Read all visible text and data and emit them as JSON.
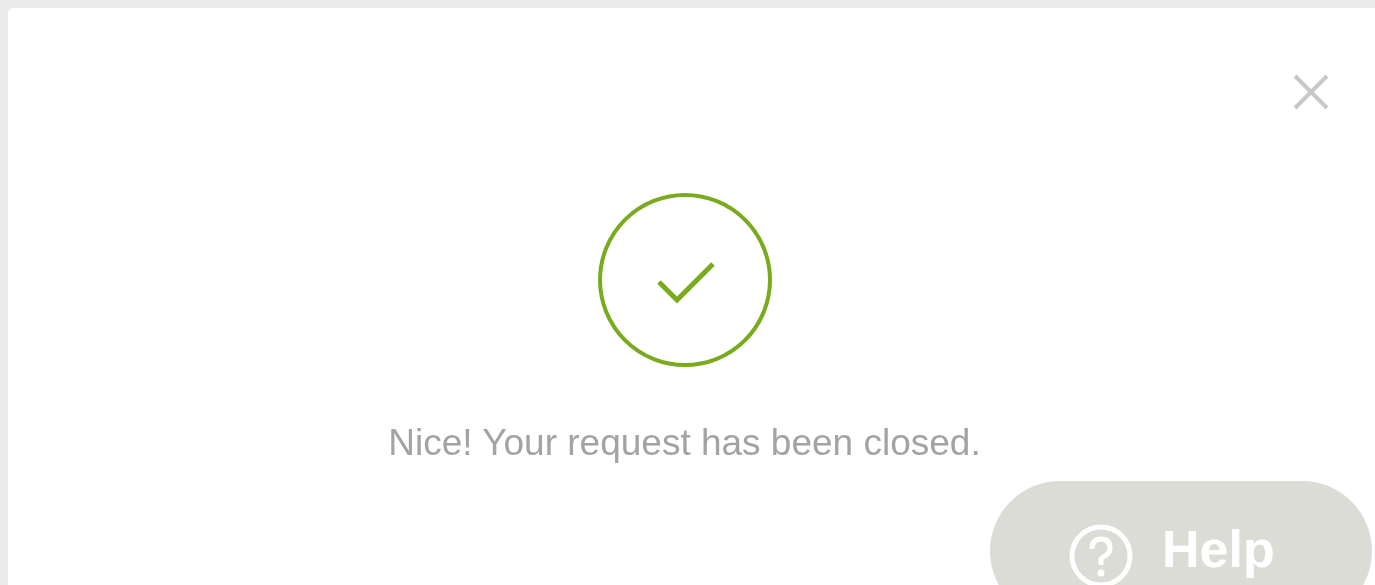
{
  "dialog": {
    "message": "Nice! Your request has been closed."
  },
  "help_button": {
    "label": "Help"
  }
}
